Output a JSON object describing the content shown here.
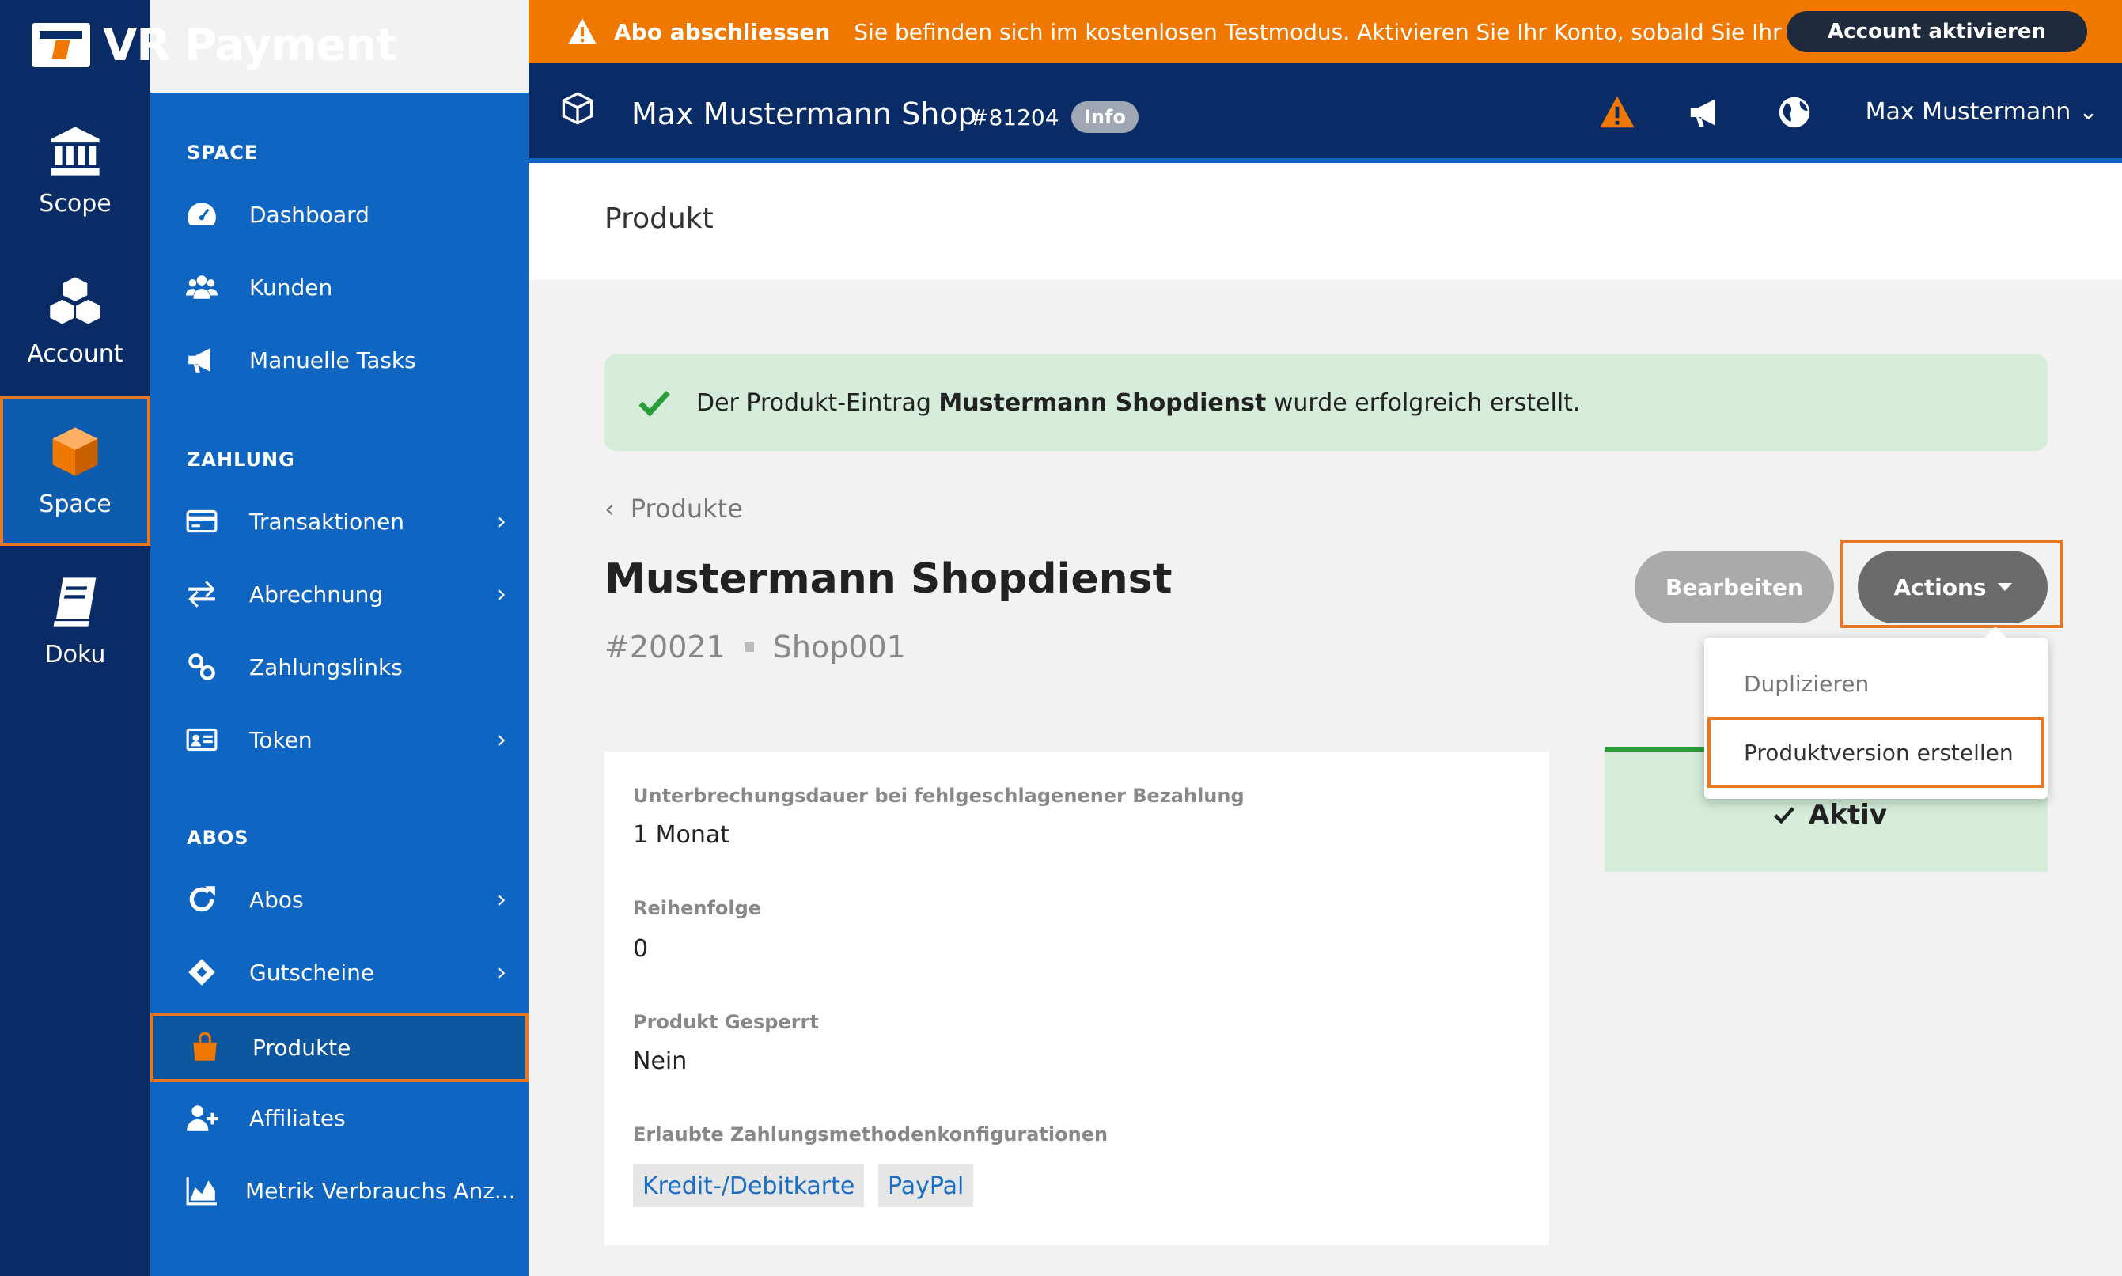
{
  "brand": {
    "name": "VR Payment"
  },
  "banner": {
    "bold_text": "Abo abschliessen",
    "message": "Sie befinden sich im kostenlosen Testmodus. Aktivieren Sie Ihr Konto, sobald Sie Ihr Zahlu...",
    "button_label": "Account aktivieren"
  },
  "rail": {
    "items": [
      {
        "label": "Scope",
        "icon": "bank-icon"
      },
      {
        "label": "Account",
        "icon": "cubes-icon"
      },
      {
        "label": "Space",
        "icon": "cube-icon"
      },
      {
        "label": "Doku",
        "icon": "book-icon"
      }
    ]
  },
  "sidebar": {
    "sections": [
      {
        "title": "SPACE"
      },
      {
        "title": "ZAHLUNG"
      },
      {
        "title": "ABOS"
      }
    ],
    "items": [
      {
        "label": "Dashboard",
        "icon": "dashboard-icon"
      },
      {
        "label": "Kunden",
        "icon": "users-icon"
      },
      {
        "label": "Manuelle Tasks",
        "icon": "megaphone-icon"
      },
      {
        "label": "Transaktionen",
        "icon": "credit-card-icon"
      },
      {
        "label": "Abrechnung",
        "icon": "exchange-icon"
      },
      {
        "label": "Zahlungslinks",
        "icon": "link-icon"
      },
      {
        "label": "Token",
        "icon": "id-card-icon"
      },
      {
        "label": "Abos",
        "icon": "refresh-icon"
      },
      {
        "label": "Gutscheine",
        "icon": "ticket-icon"
      },
      {
        "label": "Produkte",
        "icon": "shopping-bag-icon"
      },
      {
        "label": "Affiliates",
        "icon": "user-plus-icon"
      },
      {
        "label": "Metrik Verbrauchs Anz...",
        "icon": "area-chart-icon"
      }
    ]
  },
  "topbar": {
    "shop_name": "Max Mustermann Shop",
    "shop_id": "#81204",
    "badge": "Info",
    "user": "Max Mustermann"
  },
  "page": {
    "header": "Produkt",
    "alert": {
      "prefix": "Der Produkt-Eintrag ",
      "name": "Mustermann Shopdienst",
      "suffix": " wurde erfolgreich erstellt."
    },
    "back_label": "Produkte",
    "title": "Mustermann Shopdienst",
    "id": "#20021",
    "reference": "Shop001",
    "edit_label": "Bearbeiten",
    "actions_label": "Actions",
    "dropdown": {
      "duplicate": "Duplizieren",
      "create_version": "Produktversion erstellen"
    },
    "status": "Aktiv",
    "details": [
      {
        "label": "Unterbrechungsdauer bei fehlgeschlagenener Bezahlung",
        "value": "1 Monat"
      },
      {
        "label": "Reihenfolge",
        "value": "0"
      },
      {
        "label": "Produkt Gesperrt",
        "value": "Nein"
      },
      {
        "label": "Erlaubte Zahlungsmethodenkonfigurationen",
        "value": ""
      }
    ],
    "payment_methods": [
      "Kredit-/Debitkarte",
      "PayPal"
    ]
  },
  "colors": {
    "rail_bg": "#0a2c66",
    "sidebar_bg": "#0f66c2",
    "accent_orange": "#f07800",
    "highlight_border": "#e87722",
    "success_bg": "#d4ecd9"
  }
}
